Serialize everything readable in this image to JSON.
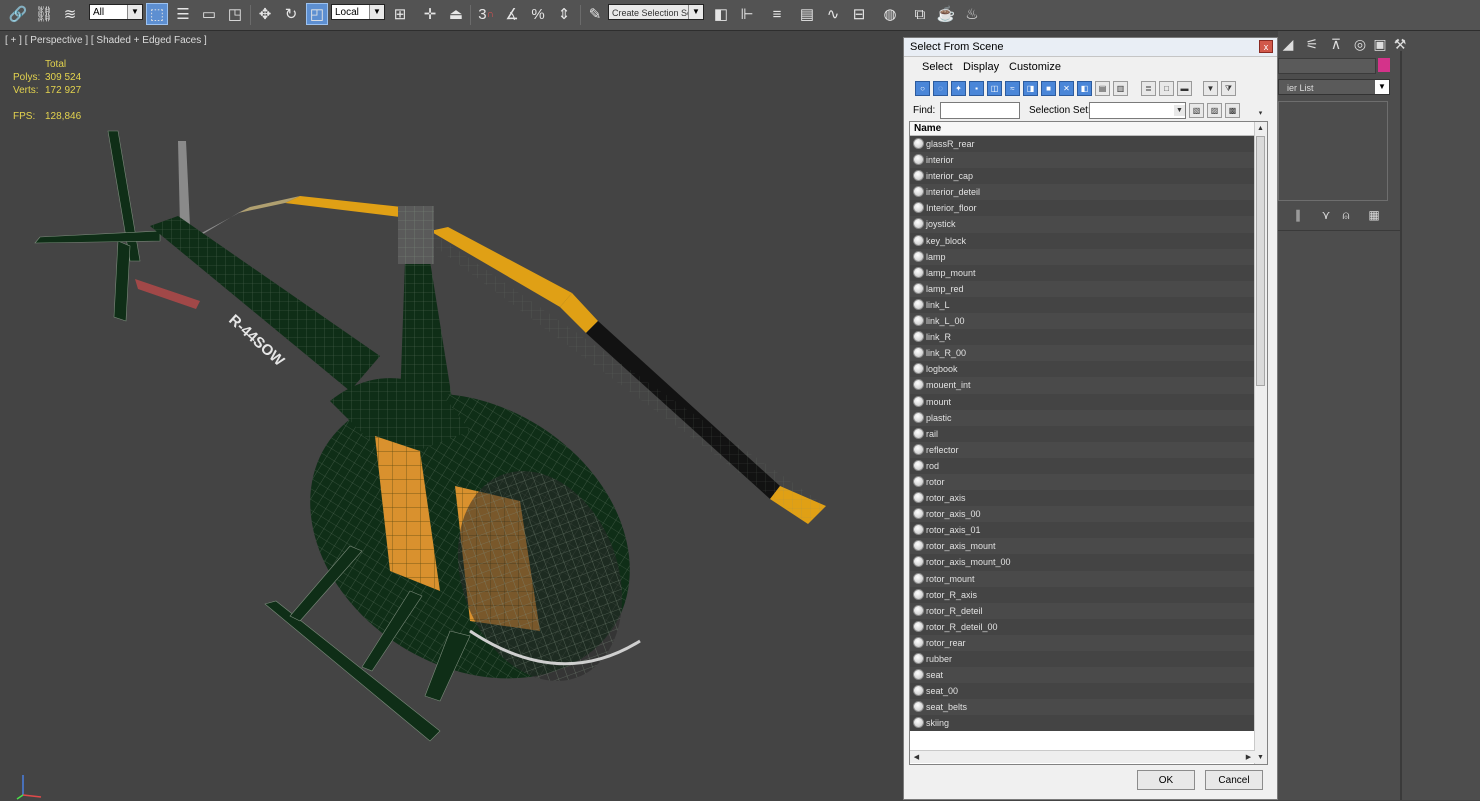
{
  "toolbar": {
    "filter_value": "All",
    "coord_value": "Local",
    "selection_set_placeholder": "Create Selection Se",
    "snap_3": "3",
    "snap_pct": "%"
  },
  "viewport": {
    "label": "[ + ] [ Perspective ] [ Shaded + Edged Faces ]",
    "stats": {
      "header": "Total",
      "polys_label": "Polys:",
      "polys_value": "309 524",
      "verts_label": "Verts:",
      "verts_value": "172 927",
      "fps_label": "FPS:",
      "fps_value": "128,846"
    },
    "model_text": "R-44SOW"
  },
  "command_panel": {
    "modifier_list": "ier List"
  },
  "dialog": {
    "title": "Select From Scene",
    "close_glyph": "x",
    "menu": [
      "Select",
      "Display",
      "Customize"
    ],
    "find_label": "Find:",
    "selection_set_label": "Selection Set:",
    "column_name": "Name",
    "items": [
      "glassR_rear",
      "interior",
      "interior_cap",
      "interior_deteil",
      "Interior_floor",
      "joystick",
      "key_block",
      "lamp",
      "lamp_mount",
      "lamp_red",
      "link_L",
      "link_L_00",
      "link_R",
      "link_R_00",
      "logbook",
      "mouent_int",
      "mount",
      "plastic",
      "rail",
      "reflector",
      "rod",
      "rotor",
      "rotor_axis",
      "rotor_axis_00",
      "rotor_axis_01",
      "rotor_axis_mount",
      "rotor_axis_mount_00",
      "rotor_mount",
      "rotor_R_axis",
      "rotor_R_deteil",
      "rotor_R_deteil_00",
      "rotor_rear",
      "rubber",
      "seat",
      "seat_00",
      "seat_belts",
      "skiing"
    ],
    "ok_label": "OK",
    "cancel_label": "Cancel"
  },
  "colors": {
    "viewport_bg": "#444444",
    "stats_text": "#e3d34e",
    "rotor_yellow": "#e0a015",
    "body_green": "#0f2e17",
    "accent_blue": "#5d8fd1",
    "magenta": "#d4338a"
  }
}
